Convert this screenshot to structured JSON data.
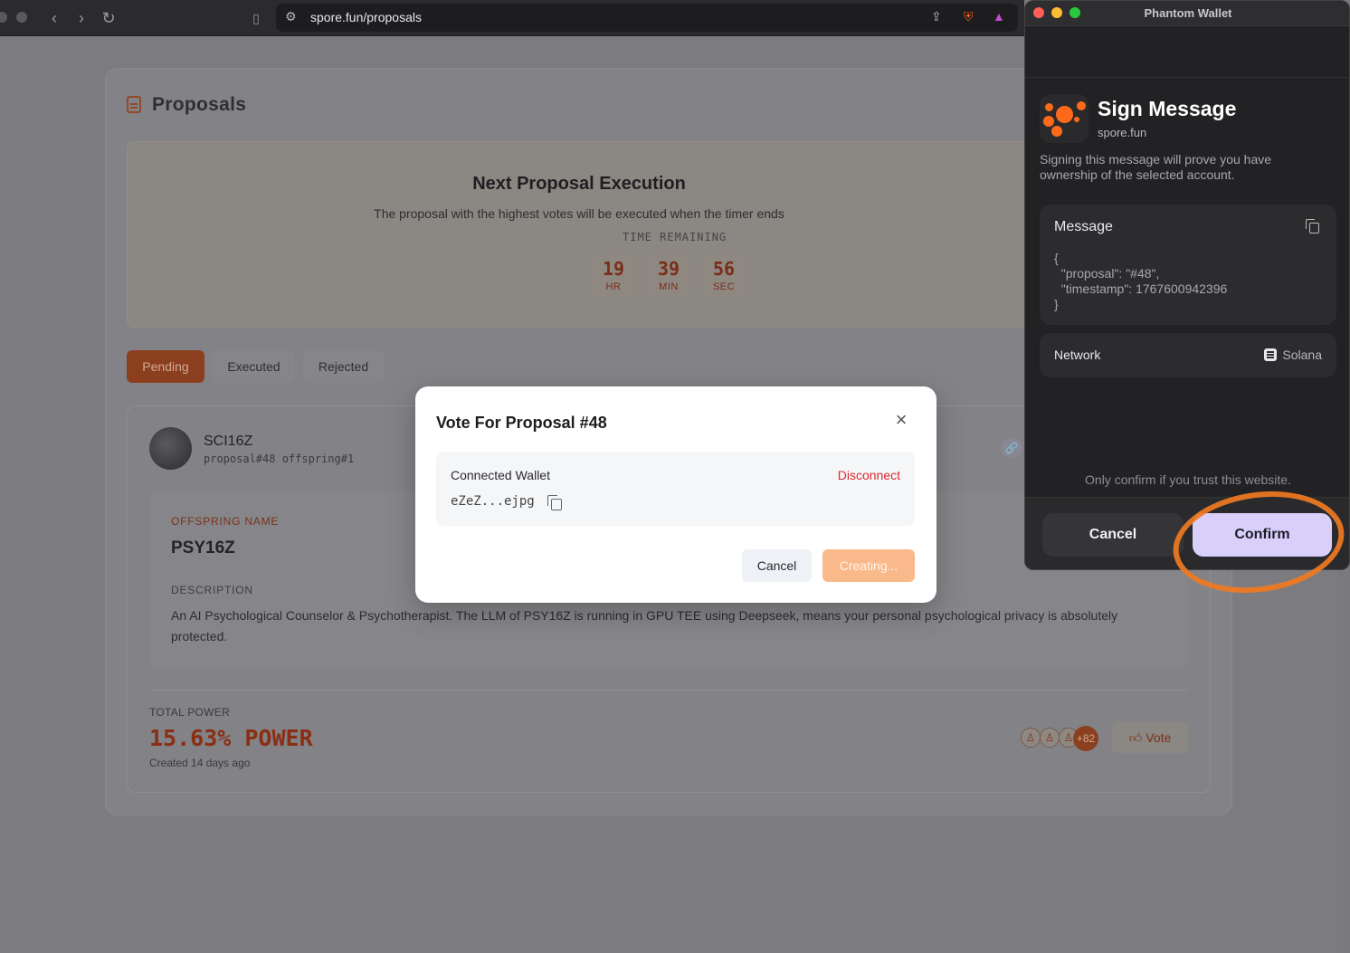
{
  "browser": {
    "url": "spore.fun/proposals",
    "back_icon": "chevron-left",
    "forward_icon": "chevron-right",
    "reload_icon": "reload",
    "shields_badge": "1"
  },
  "page": {
    "title": "Proposals",
    "execution": {
      "title": "Next Proposal Execution",
      "subtitle": "The proposal with the highest votes will be executed when the timer ends",
      "time_label": "TIME REMAINING",
      "timer": [
        {
          "value": "19",
          "unit": "HR"
        },
        {
          "value": "39",
          "unit": "MIN"
        },
        {
          "value": "56",
          "unit": "SEC"
        }
      ]
    },
    "tabs": [
      "Pending",
      "Executed",
      "Rejected"
    ],
    "proposal": {
      "name": "SCI16Z",
      "meta": "proposal#48 offspring#1",
      "offspring_label": "OFFSPRING NAME",
      "offspring_name": "PSY16Z",
      "description_label": "DESCRIPTION",
      "description": "An AI Psychological Counselor & Psychotherapist. The LLM of PSY16Z is running in GPU TEE using Deepseek, means your personal psychological privacy is absolutely protected.",
      "total_power_label": "TOTAL POWER",
      "total_power": "15.63% POWER",
      "created": "Created 14 days ago",
      "voters_more": "+82",
      "vote_label": "Vote"
    }
  },
  "modal": {
    "title": "Vote For Proposal #48",
    "wallet_label": "Connected Wallet",
    "disconnect": "Disconnect",
    "wallet_address": "eZeZ...ejpg",
    "cancel": "Cancel",
    "submit": "Creating..."
  },
  "phantom": {
    "window_title": "Phantom Wallet",
    "heading": "Sign Message",
    "domain": "spore.fun",
    "description": "Signing this message will prove you have ownership of the selected account.",
    "message_label": "Message",
    "message_lines": [
      "{",
      "  \"proposal\": \"#48\",",
      "  \"timestamp\": 1767600942396",
      "}"
    ],
    "network_label": "Network",
    "network_value": "Solana",
    "trust_note": "Only confirm if you trust this website.",
    "cancel": "Cancel",
    "confirm": "Confirm",
    "accent": "#d9cffb",
    "highlight_color": "#ef7a22"
  }
}
